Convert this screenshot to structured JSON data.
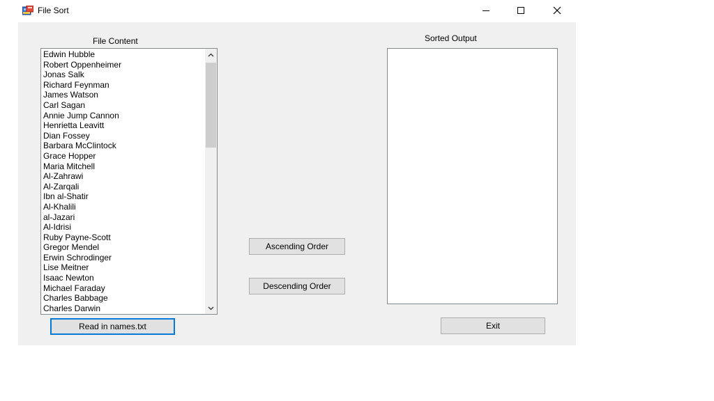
{
  "window": {
    "title": "File Sort"
  },
  "labels": {
    "file_content": "File Content",
    "sorted_output": "Sorted Output"
  },
  "file_content_items": [
    "Edwin Hubble",
    "Robert Oppenheimer",
    "Jonas Salk",
    "Richard Feynman",
    "James Watson",
    "Carl Sagan",
    "Annie Jump Cannon",
    "Henrietta Leavitt",
    "Dian Fossey",
    "Barbara McClintock",
    "Grace Hopper",
    "Maria Mitchell",
    "Al-Zahrawi",
    "Al-Zarqali",
    "Ibn al-Shatir",
    "Al-Khalili",
    "al-Jazari",
    "Al-Idrisi",
    "Ruby Payne-Scott",
    "Gregor Mendel",
    "Erwin Schrodinger",
    "Lise Meitner",
    "Isaac Newton",
    "Michael Faraday",
    "Charles Babbage",
    "Charles Darwin"
  ],
  "sorted_output_items": [],
  "buttons": {
    "ascending": "Ascending Order",
    "descending": "Descending Order",
    "read_names": "Read in names.txt",
    "exit": "Exit"
  },
  "colors": {
    "client_bg": "#f0f0f0",
    "button_bg": "#e1e1e1",
    "focus_border": "#0078d7"
  }
}
